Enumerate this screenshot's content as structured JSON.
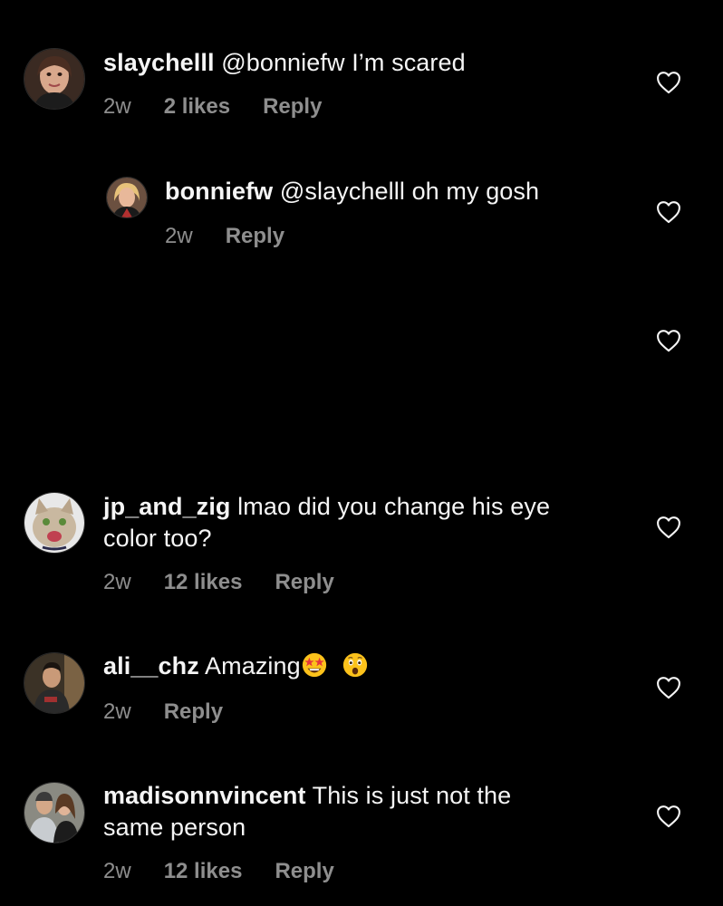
{
  "colors": {
    "background": "#000000",
    "text": "#f5f5f5",
    "meta": "#8e8e8e"
  },
  "comments": [
    {
      "username": "slaychelll",
      "mention": "@bonniefw",
      "text": "I’m scared",
      "time": "2w",
      "likes": "2 likes",
      "reply": "Reply",
      "icon": "heart-outline-icon"
    },
    {
      "username": "bonniefw",
      "mention": "@slaychelll",
      "text": "oh my gosh",
      "time": "2w",
      "reply": "Reply",
      "icon": "heart-outline-icon"
    },
    {
      "icon": "heart-outline-icon"
    },
    {
      "username": "jp_and_zig",
      "text_line1": "lmao did you change his eye",
      "text_line2": "color too?",
      "time": "2w",
      "likes": "12 likes",
      "reply": "Reply",
      "icon": "heart-outline-icon"
    },
    {
      "username": "ali__chz",
      "text": "Amazing",
      "emojis": [
        "star-struck-emoji",
        "astonished-face-emoji"
      ],
      "time": "2w",
      "reply": "Reply",
      "icon": "heart-outline-icon"
    },
    {
      "username": "madisonnvincent",
      "text_line1": "This is just not the",
      "text_line2": "same person",
      "time": "2w",
      "likes": "12 likes",
      "reply": "Reply",
      "icon": "heart-outline-icon"
    }
  ]
}
